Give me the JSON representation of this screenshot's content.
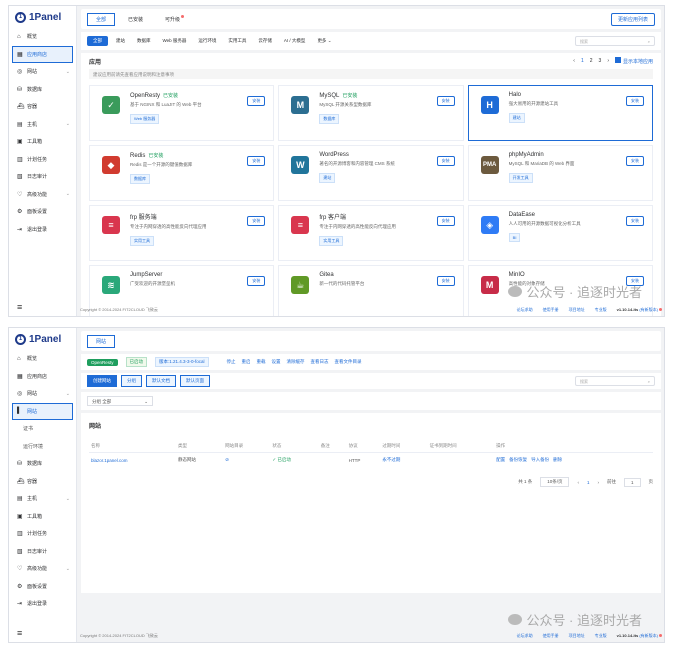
{
  "brand": {
    "logo_text": "1Panel",
    "logo_mark": "1"
  },
  "shot1": {
    "nav": [
      {
        "label": "概览",
        "icon": "⌂",
        "active": false,
        "chevron": false
      },
      {
        "label": "应用商店",
        "icon": "▦",
        "active": true,
        "chevron": false
      },
      {
        "label": "网站",
        "icon": "◎",
        "active": false,
        "chevron": true
      },
      {
        "label": "数据库",
        "icon": "⛁",
        "active": false,
        "chevron": false
      },
      {
        "label": "容器",
        "icon": "⛴",
        "active": false,
        "chevron": false
      },
      {
        "label": "主机",
        "icon": "▤",
        "active": false,
        "chevron": true
      },
      {
        "label": "工具箱",
        "icon": "▣",
        "active": false,
        "chevron": false
      },
      {
        "label": "计划任务",
        "icon": "▥",
        "active": false,
        "chevron": false
      },
      {
        "label": "日志审计",
        "icon": "▧",
        "active": false,
        "chevron": false
      },
      {
        "label": "高级功能",
        "icon": "♡",
        "active": false,
        "chevron": true
      },
      {
        "label": "面板设置",
        "icon": "⚙",
        "active": false,
        "chevron": false
      },
      {
        "label": "退出登录",
        "icon": "⇥",
        "active": false,
        "chevron": false
      }
    ],
    "tabs": [
      {
        "label": "全部",
        "active": true,
        "dot": false
      },
      {
        "label": "已安装",
        "active": false,
        "dot": false
      },
      {
        "label": "可升级",
        "active": false,
        "dot": true
      }
    ],
    "sync_button": "更新应用列表",
    "filters": [
      {
        "label": "全部",
        "on": true
      },
      {
        "label": "建站",
        "on": false
      },
      {
        "label": "数据库",
        "on": false
      },
      {
        "label": "Web 服务器",
        "on": false
      },
      {
        "label": "运行环境",
        "on": false
      },
      {
        "label": "实用工具",
        "on": false
      },
      {
        "label": "云存储",
        "on": false
      },
      {
        "label": "AI / 大模型",
        "on": false
      },
      {
        "label": "更多 ⌄",
        "on": false
      }
    ],
    "search_placeholder": "搜索",
    "section_title": "应用",
    "pager": {
      "prev": "‹",
      "pages": [
        "1",
        "2",
        "3"
      ],
      "next": "›",
      "checkbox_label": "显示本地应用"
    },
    "hint": "建议应用前请先查看应用说明和注意事项",
    "apps": [
      {
        "name": "OpenResty",
        "installed": "已安装",
        "desc": "基于 NGINX 和 LuaJIT 的 Web 平台",
        "tag": "Web 服务器",
        "btn": "安装",
        "icon_text": "✓",
        "icon_color": "#3a9b5b",
        "highlight": false
      },
      {
        "name": "MySQL",
        "installed": "已安装",
        "desc": "MySQL 开源关系型数据库",
        "tag": "数据库",
        "btn": "安装",
        "icon_text": "M",
        "icon_color": "#2c6e91",
        "highlight": false
      },
      {
        "name": "Halo",
        "installed": "",
        "desc": "强大易用的开源建站工具",
        "tag": "建站",
        "btn": "安装",
        "icon_text": "H",
        "icon_color": "#1e6bd6",
        "highlight": true
      },
      {
        "name": "Redis",
        "installed": "已安装",
        "desc": "Redis 是一个开源的键值数据库",
        "tag": "数据库",
        "btn": "安装",
        "icon_text": "◆",
        "icon_color": "#d13b2f",
        "highlight": false
      },
      {
        "name": "WordPress",
        "installed": "",
        "desc": "著名的开源博客和内容管理 CMS 系统",
        "tag": "建站",
        "btn": "安装",
        "icon_text": "W",
        "icon_color": "#21759b",
        "highlight": false
      },
      {
        "name": "phpMyAdmin",
        "installed": "",
        "desc": "MySQL 和 MariaDB 的 Web 界面",
        "tag": "开发工具",
        "btn": "安装",
        "icon_text": "PMA",
        "icon_color": "#6c5a3e",
        "highlight": false
      },
      {
        "name": "frp 服务端",
        "installed": "",
        "desc": "专注于内网穿透的高性能反向代理应用",
        "tag": "实用工具",
        "btn": "安装",
        "icon_text": "≡",
        "icon_color": "#d9364e",
        "highlight": false
      },
      {
        "name": "frp 客户端",
        "installed": "",
        "desc": "专注于内网穿透的高性能反向代理应用",
        "tag": "实用工具",
        "btn": "安装",
        "icon_text": "≡",
        "icon_color": "#d9364e",
        "highlight": false
      },
      {
        "name": "DataEase",
        "installed": "",
        "desc": "人人可用的开源数据可视化分析工具",
        "tag": "BI",
        "btn": "安装",
        "icon_text": "◈",
        "icon_color": "#2f7bf5",
        "highlight": false
      },
      {
        "name": "JumpServer",
        "installed": "",
        "desc": "广受欢迎的开源堡垒机",
        "tag": "",
        "btn": "安装",
        "icon_text": "≋",
        "icon_color": "#2aa87a",
        "highlight": false
      },
      {
        "name": "Gitea",
        "installed": "",
        "desc": "新一代的代码托管平台",
        "tag": "",
        "btn": "安装",
        "icon_text": "☕",
        "icon_color": "#609926",
        "highlight": false
      },
      {
        "name": "MinIO",
        "installed": "",
        "desc": "高性能的对象存储",
        "tag": "",
        "btn": "安装",
        "icon_text": "M",
        "icon_color": "#c72c48",
        "highlight": false
      }
    ],
    "footer": {
      "copyright": "Copyright © 2014-2024 FIT2CLOUD 飞致云",
      "links": [
        "论坛求助",
        "使用手册",
        "项目地址",
        "专业版"
      ],
      "version": "v1.10.14-lts",
      "update": "(有新版本)"
    },
    "watermark": "公众号 · 追逐时光者"
  },
  "shot2": {
    "nav": [
      {
        "label": "概览",
        "icon": "⌂",
        "active": false,
        "sub": false,
        "chevron": false
      },
      {
        "label": "应用商店",
        "icon": "▦",
        "active": false,
        "sub": false,
        "chevron": false
      },
      {
        "label": "网站",
        "icon": "◎",
        "active": false,
        "sub": false,
        "chevron": true
      },
      {
        "label": "网站",
        "icon": "▌",
        "active": true,
        "sub": false,
        "chevron": false
      },
      {
        "label": "证书",
        "icon": "",
        "active": false,
        "sub": true,
        "chevron": false
      },
      {
        "label": "运行环境",
        "icon": "",
        "active": false,
        "sub": true,
        "chevron": false
      },
      {
        "label": "数据库",
        "icon": "⛁",
        "active": false,
        "sub": false,
        "chevron": false
      },
      {
        "label": "容器",
        "icon": "⛴",
        "active": false,
        "sub": false,
        "chevron": false
      },
      {
        "label": "主机",
        "icon": "▤",
        "active": false,
        "sub": false,
        "chevron": true
      },
      {
        "label": "工具箱",
        "icon": "▣",
        "active": false,
        "sub": false,
        "chevron": false
      },
      {
        "label": "计划任务",
        "icon": "▥",
        "active": false,
        "sub": false,
        "chevron": false
      },
      {
        "label": "日志审计",
        "icon": "▧",
        "active": false,
        "sub": false,
        "chevron": false
      },
      {
        "label": "高级功能",
        "icon": "♡",
        "active": false,
        "sub": false,
        "chevron": true
      },
      {
        "label": "面板设置",
        "icon": "⚙",
        "active": false,
        "sub": false,
        "chevron": false
      },
      {
        "label": "退出登录",
        "icon": "⇥",
        "active": false,
        "sub": false,
        "chevron": false
      }
    ],
    "tab": "网站",
    "status": {
      "app": "OpenResty",
      "state": "已启动",
      "version": "版本:1.21.4.3-3-0-focal",
      "links": [
        "停止",
        "重启",
        "重载",
        "设置",
        "清除缓存",
        "查看日志",
        "查看文件目录"
      ]
    },
    "actions": [
      {
        "label": "创建网站",
        "primary": true
      },
      {
        "label": "分组",
        "primary": false
      },
      {
        "label": "默认文档",
        "primary": false
      },
      {
        "label": "默认页面",
        "primary": false
      }
    ],
    "search_placeholder": "搜索",
    "group_select": {
      "prefix": "分组",
      "value": "全部",
      "chevron": "⌄"
    },
    "table_title": "网站",
    "columns": [
      "名称",
      "类型",
      "网站目录",
      "状态",
      "备注",
      "协议",
      "过期时间",
      "证书到期时间",
      "操作"
    ],
    "rows": [
      {
        "name": "blazor.1panel.com",
        "type": "静态网站",
        "dir": "⊘",
        "status": "✓ 已启动",
        "remark": "",
        "proto": "HTTP",
        "expire": "永不过期",
        "cert": "",
        "ops": [
          "配置",
          "备份恢复",
          "导入备份",
          "删除"
        ]
      }
    ],
    "pagination": {
      "total": "共 1 条",
      "page_size": "10条/页",
      "prev": "‹",
      "page": "1",
      "next": "›",
      "goto": "前往",
      "goto_value": "1",
      "unit": "页"
    },
    "footer": {
      "copyright": "Copyright © 2014-2024 FIT2CLOUD 飞致云",
      "links": [
        "论坛求助",
        "使用手册",
        "项目地址",
        "专业版"
      ],
      "version": "v1.10.14-lts",
      "update": "(有新版本)"
    },
    "watermark": "公众号 · 追逐时光者"
  }
}
